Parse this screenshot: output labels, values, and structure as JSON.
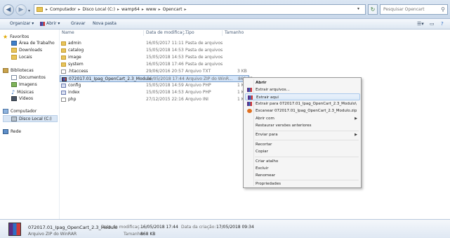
{
  "address_bar": {
    "breadcrumbs": [
      "Computador",
      "Disco Local (C:)",
      "wamp64",
      "www",
      "Opencart"
    ],
    "search_placeholder": "Pesquisar Opencart"
  },
  "toolbar": {
    "organize_label": "Organizar ▾",
    "open_label": "Abrir ▾",
    "burn_label": "Gravar",
    "new_folder_label": "Nova pasta"
  },
  "sidebar": {
    "favorites": "Favoritos",
    "desktop": "Área de Trabalho",
    "downloads": "Downloads",
    "places": "Locais",
    "libraries": "Bibliotecas",
    "documents": "Documentos",
    "images": "Imagens",
    "music": "Músicas",
    "videos": "Vídeos",
    "computer": "Computador",
    "local_disk": "Disco Local (C:)",
    "network": "Rede"
  },
  "columns": {
    "name": "Name",
    "date": "Data de modificaç...",
    "type": "Tipo",
    "size": "Tamanho"
  },
  "files": [
    {
      "name": "admin",
      "date": "16/05/2017 11:11",
      "type": "Pasta de arquivos",
      "size": ""
    },
    {
      "name": "catalog",
      "date": "15/05/2018 14:53",
      "type": "Pasta de arquivos",
      "size": ""
    },
    {
      "name": "image",
      "date": "15/05/2018 14:53",
      "type": "Pasta de arquivos",
      "size": ""
    },
    {
      "name": "system",
      "date": "16/05/2018 17:46",
      "type": "Pasta de arquivos",
      "size": ""
    },
    {
      "name": ".htaccess",
      "date": "29/06/2016 20:57",
      "type": "Arquivo TXT",
      "size": "3 KB"
    },
    {
      "name": "072017.01_Ipag_OpenCart_2.3_Modulo",
      "date": "16/05/2018 17:44",
      "type": "Arquivo ZIP do WinR...",
      "size": "869 KB"
    },
    {
      "name": "config",
      "date": "15/05/2018 14:59",
      "type": "Arquivo PHP",
      "size": "1 KB"
    },
    {
      "name": "index",
      "date": "15/05/2018 14:53",
      "type": "Arquivo PHP",
      "size": "1 KB"
    },
    {
      "name": "php",
      "date": "27/12/2015 22:16",
      "type": "Arquivo INI",
      "size": "1 KB"
    }
  ],
  "context_menu": {
    "open": "Abrir",
    "extract_files": "Extrair arquivos...",
    "extract_here": "Extrair aqui",
    "extract_to": "Extrair para 072017.01_Ipag_OpenCart_2.3_Modulo\\",
    "scan": "Escanear 072017.01_Ipag_OpenCart_2.3_Modulo.zip",
    "open_with": "Abrir com",
    "restore": "Restaurar versões anteriores",
    "send_to": "Enviar para",
    "cut": "Recortar",
    "copy": "Copiar",
    "create_shortcut": "Criar atalho",
    "delete": "Excluir",
    "rename": "Renomear",
    "properties": "Propriedades"
  },
  "details": {
    "name": "072017.01_Ipag_OpenCart_2.3_Modulo",
    "type": "Arquivo ZIP do WinRAR",
    "modified_label": "Data de modificaç...",
    "modified_value": "16/05/2018 17:44",
    "size_label": "Tamanho:",
    "size_value": "868 KB",
    "created_label": "Data da criação:",
    "created_value": "17/05/2018 09:34"
  },
  "colors": {
    "selection": "#d2e3f7",
    "folder": "#e8c45a",
    "toolbar_text": "#1e395b"
  }
}
